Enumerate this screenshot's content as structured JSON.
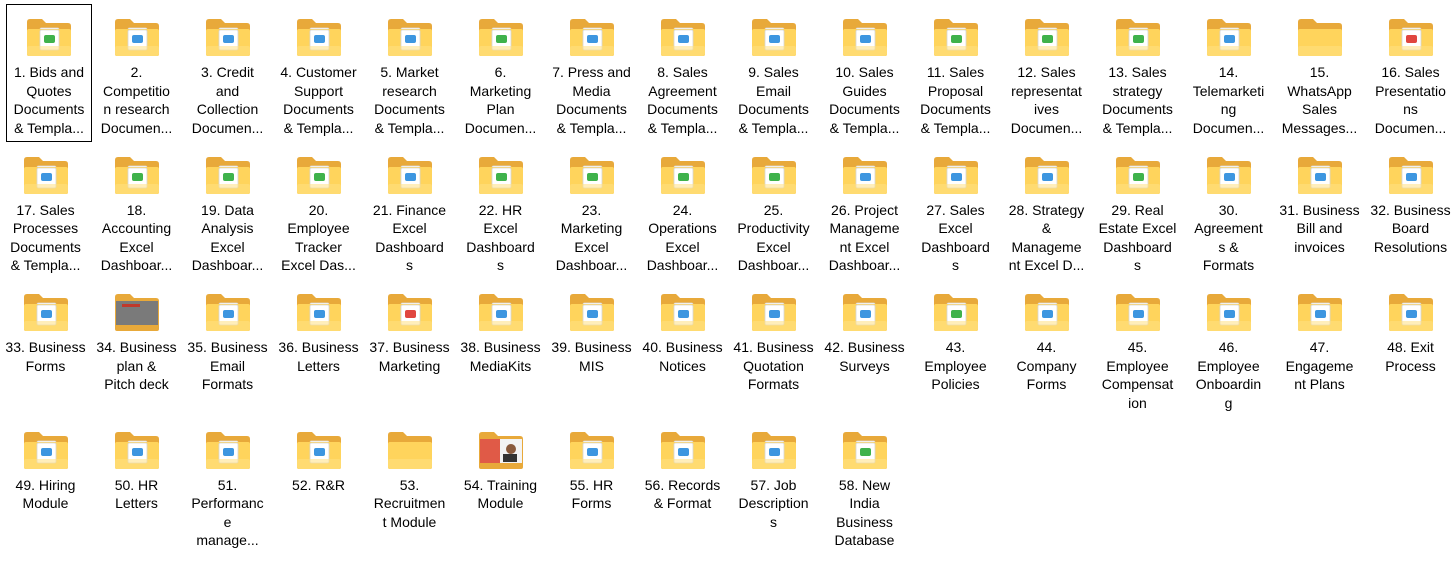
{
  "colors": {
    "folder_back": "#e8a93a",
    "folder_front": "#ffd45c",
    "folder_front_light": "#ffe083",
    "doc_blue": "#3d96e0",
    "doc_green": "#3fb24b",
    "doc_red": "#e0463f",
    "selection_border": "#000000"
  },
  "items": [
    {
      "label": "1. Bids and\nQuotes\nDocuments\n& Templa...",
      "icon": "folder-doc-green-icon",
      "badge": "green",
      "selected": true
    },
    {
      "label": "2.\nCompetitio\nn research\nDocumen...",
      "icon": "folder-doc-blue-icon",
      "badge": "blue"
    },
    {
      "label": "3. Credit\nand\nCollection\nDocumen...",
      "icon": "folder-doc-blue-icon",
      "badge": "blue"
    },
    {
      "label": "4. Customer\nSupport\nDocuments\n& Templa...",
      "icon": "folder-doc-blue-icon",
      "badge": "blue"
    },
    {
      "label": "5. Market\nresearch\nDocuments\n& Templa...",
      "icon": "folder-doc-blue-icon",
      "badge": "blue"
    },
    {
      "label": "6.\nMarketing\nPlan\nDocumen...",
      "icon": "folder-doc-green-icon",
      "badge": "green"
    },
    {
      "label": "7. Press and\nMedia\nDocuments\n& Templa...",
      "icon": "folder-doc-blue-icon",
      "badge": "blue"
    },
    {
      "label": "8. Sales\nAgreement\nDocuments\n& Templa...",
      "icon": "folder-doc-blue-icon",
      "badge": "blue"
    },
    {
      "label": "9. Sales\nEmail\nDocuments\n& Templa...",
      "icon": "folder-doc-blue-icon",
      "badge": "blue"
    },
    {
      "label": "10. Sales\nGuides\nDocuments\n& Templa...",
      "icon": "folder-doc-blue-icon",
      "badge": "blue"
    },
    {
      "label": "11. Sales\nProposal\nDocuments\n& Templa...",
      "icon": "folder-doc-green-icon",
      "badge": "green"
    },
    {
      "label": "12. Sales\nrepresentat\nives\nDocumen...",
      "icon": "folder-doc-green-icon",
      "badge": "green"
    },
    {
      "label": "13. Sales\nstrategy\nDocuments\n& Templa...",
      "icon": "folder-doc-green-icon",
      "badge": "green"
    },
    {
      "label": "14.\nTelemarketi\nng\nDocumen...",
      "icon": "folder-doc-blue-icon",
      "badge": "blue"
    },
    {
      "label": "15.\nWhatsApp\nSales\nMessages...",
      "icon": "folder-empty-icon",
      "badge": "none"
    },
    {
      "label": "16. Sales\nPresentatio\nns\nDocumen...",
      "icon": "folder-doc-red-icon",
      "badge": "red"
    },
    {
      "label": "17. Sales\nProcesses\nDocuments\n& Templa...",
      "icon": "folder-doc-blue-icon",
      "badge": "blue"
    },
    {
      "label": "18.\nAccounting\nExcel\nDashboar...",
      "icon": "folder-doc-green-icon",
      "badge": "green"
    },
    {
      "label": "19. Data\nAnalysis\nExcel\nDashboar...",
      "icon": "folder-doc-green-icon",
      "badge": "green"
    },
    {
      "label": "20.\nEmployee\nTracker\nExcel Das...",
      "icon": "folder-doc-green-icon",
      "badge": "green"
    },
    {
      "label": "21. Finance\nExcel\nDashboard\ns",
      "icon": "folder-doc-blue-icon",
      "badge": "blue"
    },
    {
      "label": "22. HR\nExcel\nDashboard\ns",
      "icon": "folder-doc-green-icon",
      "badge": "green"
    },
    {
      "label": "23.\nMarketing\nExcel\nDashboar...",
      "icon": "folder-doc-green-icon",
      "badge": "green"
    },
    {
      "label": "24.\nOperations\nExcel\nDashboar...",
      "icon": "folder-doc-green-icon",
      "badge": "green"
    },
    {
      "label": "25.\nProductivity\nExcel\nDashboar...",
      "icon": "folder-doc-green-icon",
      "badge": "green"
    },
    {
      "label": "26. Project\nManageme\nnt Excel\nDashboar...",
      "icon": "folder-doc-blue-icon",
      "badge": "blue"
    },
    {
      "label": "27. Sales\nExcel\nDashboard\ns",
      "icon": "folder-doc-blue-icon",
      "badge": "blue"
    },
    {
      "label": "28. Strategy\n&\nManageme\nnt Excel D...",
      "icon": "folder-doc-blue-icon",
      "badge": "blue"
    },
    {
      "label": "29. Real\nEstate Excel\nDashboard\ns",
      "icon": "folder-doc-green-icon",
      "badge": "green"
    },
    {
      "label": "30.\nAgreement\ns &\nFormats",
      "icon": "folder-doc-blue-icon",
      "badge": "blue"
    },
    {
      "label": "31. Business\nBill and\ninvoices",
      "icon": "folder-doc-blue-icon",
      "badge": "blue"
    },
    {
      "label": "32. Business\nBoard\nResolutions",
      "icon": "folder-doc-blue-icon",
      "badge": "blue"
    },
    {
      "label": "33. Business\nForms",
      "icon": "folder-doc-blue-icon",
      "badge": "blue"
    },
    {
      "label": "34. Business\nplan &\nPitch deck",
      "icon": "folder-image-icon",
      "badge": "image"
    },
    {
      "label": "35. Business\nEmail\nFormats",
      "icon": "folder-doc-blue-icon",
      "badge": "blue"
    },
    {
      "label": "36. Business\nLetters",
      "icon": "folder-doc-blue-icon",
      "badge": "blue"
    },
    {
      "label": "37. Business\nMarketing",
      "icon": "folder-doc-red-icon",
      "badge": "red"
    },
    {
      "label": "38. Business\nMediaKits",
      "icon": "folder-doc-blue-icon",
      "badge": "blue"
    },
    {
      "label": "39. Business\nMIS",
      "icon": "folder-doc-blue-icon",
      "badge": "blue"
    },
    {
      "label": "40. Business\nNotices",
      "icon": "folder-doc-blue-icon",
      "badge": "blue"
    },
    {
      "label": "41. Business\nQuotation\nFormats",
      "icon": "folder-doc-blue-icon",
      "badge": "blue"
    },
    {
      "label": "42. Business\nSurveys",
      "icon": "folder-doc-blue-icon",
      "badge": "blue"
    },
    {
      "label": "43.\nEmployee\nPolicies",
      "icon": "folder-doc-green-icon",
      "badge": "green"
    },
    {
      "label": "44.\nCompany\nForms",
      "icon": "folder-doc-blue-icon",
      "badge": "blue"
    },
    {
      "label": "45.\nEmployee\nCompensat\nion",
      "icon": "folder-doc-blue-icon",
      "badge": "blue"
    },
    {
      "label": "46.\nEmployee\nOnboardin\ng",
      "icon": "folder-doc-blue-icon",
      "badge": "blue"
    },
    {
      "label": "47.\nEngageme\nnt Plans",
      "icon": "folder-doc-blue-icon",
      "badge": "blue"
    },
    {
      "label": "48. Exit\nProcess",
      "icon": "folder-doc-blue-icon",
      "badge": "blue"
    },
    {
      "label": "49. Hiring\nModule",
      "icon": "folder-doc-blue-icon",
      "badge": "blue"
    },
    {
      "label": "50. HR\nLetters",
      "icon": "folder-doc-blue-icon",
      "badge": "blue"
    },
    {
      "label": "51.\nPerformanc\ne\nmanage...",
      "icon": "folder-doc-blue-icon",
      "badge": "blue"
    },
    {
      "label": "52. R&R",
      "icon": "folder-doc-blue-icon",
      "badge": "blue"
    },
    {
      "label": "53.\nRecruitmen\nt Module",
      "icon": "folder-empty-icon",
      "badge": "none"
    },
    {
      "label": "54. Training\nModule",
      "icon": "folder-image-icon",
      "badge": "image2"
    },
    {
      "label": "55. HR\nForms",
      "icon": "folder-doc-blue-icon",
      "badge": "blue"
    },
    {
      "label": "56. Records\n& Format",
      "icon": "folder-doc-blue-icon",
      "badge": "blue"
    },
    {
      "label": "57. Job\nDescription\ns",
      "icon": "folder-doc-blue-icon",
      "badge": "blue"
    },
    {
      "label": "58. New\nIndia\nBusiness\nDatabase",
      "icon": "folder-doc-green-icon",
      "badge": "green"
    }
  ]
}
